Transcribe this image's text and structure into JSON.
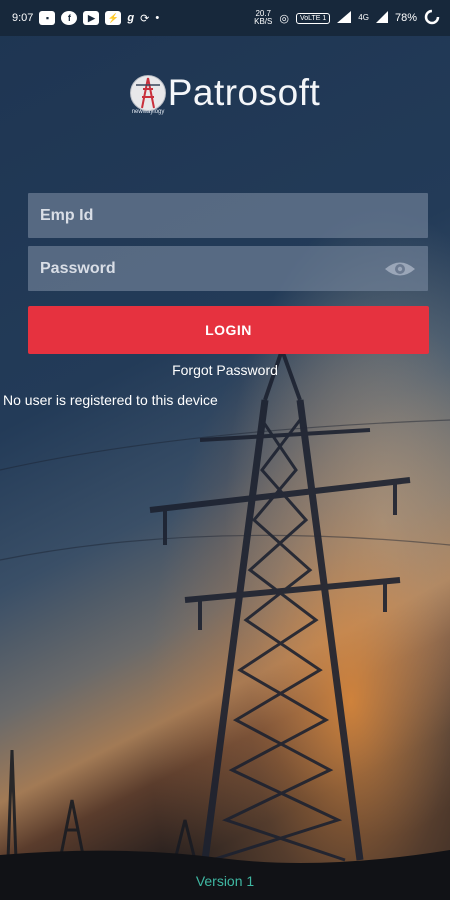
{
  "status_bar": {
    "time": "9:07",
    "speed_value": "20.7",
    "speed_unit": "KB/S",
    "network": "VoLTE 1",
    "signal_tag": "4G",
    "battery": "78%",
    "icons": [
      "message-icon",
      "facebook-icon",
      "youtube-icon",
      "messenger-icon",
      "g-icon",
      "sync-icon",
      "dot-icon",
      "hotspot-icon",
      "signal-icon",
      "battery-icon"
    ]
  },
  "logo": {
    "name": "Patrosoft",
    "sub": "newwaylogy"
  },
  "form": {
    "emp_id_placeholder": "Emp Id",
    "emp_id_value": "",
    "password_placeholder": "Password",
    "password_value": "",
    "login_label": "LOGIN",
    "forgot_label": "Forgot Password"
  },
  "notice": "No user is registered to this device",
  "version": "Version 1",
  "colors": {
    "accent_red": "#e6323f",
    "version_teal": "#3fb7a2",
    "status_bar_bg": "#17283b"
  }
}
